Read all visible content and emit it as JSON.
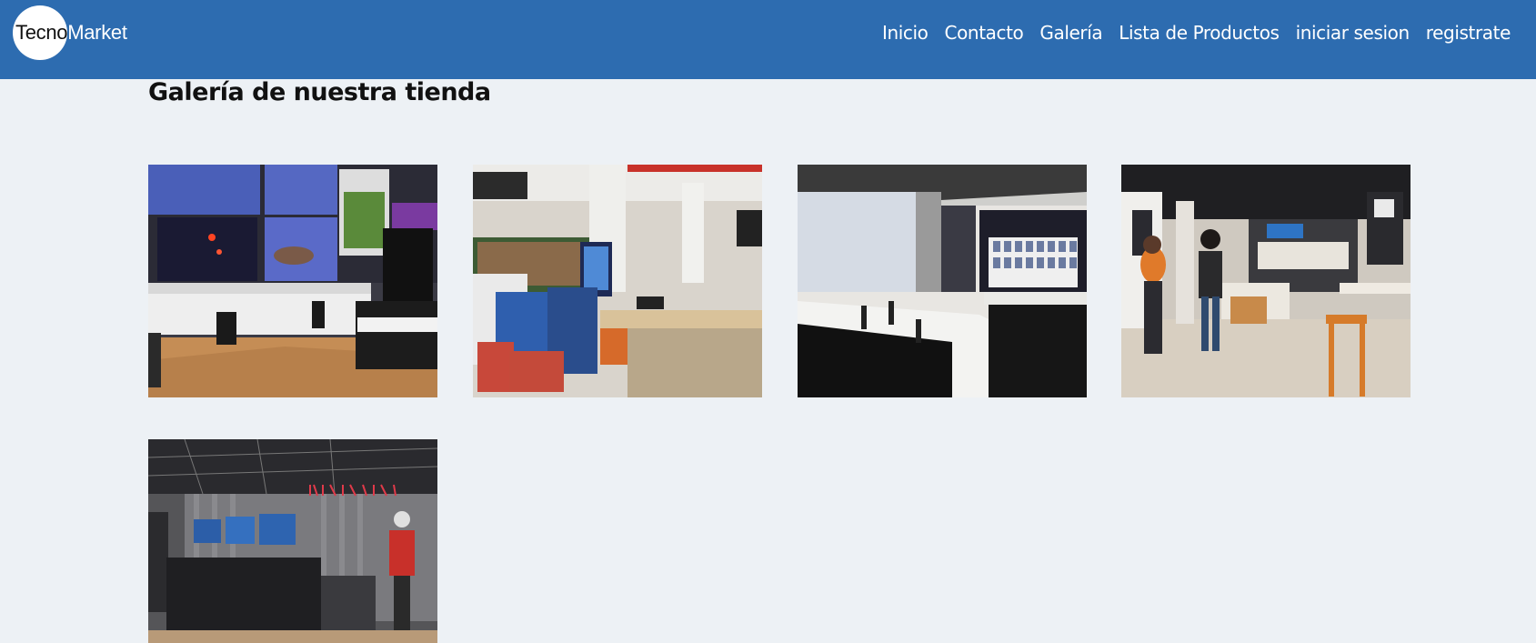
{
  "header": {
    "logo": {
      "part1": "Tecno",
      "part2": "Market"
    },
    "nav": [
      {
        "label": "Inicio"
      },
      {
        "label": "Contacto"
      },
      {
        "label": "Galería"
      },
      {
        "label": "Lista de Productos"
      },
      {
        "label": "iniciar sesion"
      },
      {
        "label": "registrate"
      }
    ]
  },
  "main": {
    "title": "Galería de nuestra tienda",
    "photos": [
      {
        "icon": "store-photo-tv-wall"
      },
      {
        "icon": "store-photo-books-toys"
      },
      {
        "icon": "store-photo-phone-counters"
      },
      {
        "icon": "store-photo-people-walking"
      },
      {
        "icon": "store-photo-dark-showroom"
      }
    ]
  },
  "colors": {
    "header_bg": "#2d6cb0",
    "page_bg": "#edf1f5",
    "nav_text": "#ffffff"
  }
}
